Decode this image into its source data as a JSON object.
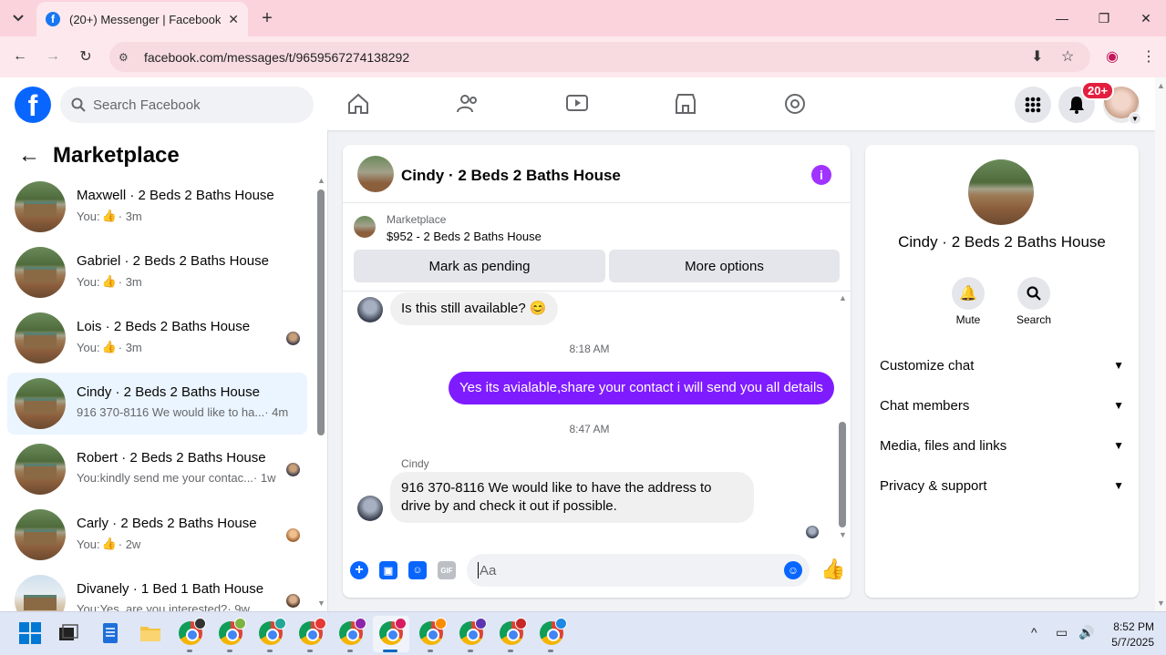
{
  "browser": {
    "tab_title": "(20+) Messenger | Facebook",
    "url": "facebook.com/messages/t/9659567274138292"
  },
  "header": {
    "search_placeholder": "Search Facebook",
    "notification_count": "20+"
  },
  "left_panel": {
    "title": "Marketplace",
    "conversations": [
      {
        "name": "Maxwell · 2 Beds 2 Baths House",
        "prefix": "You:",
        "preview": "",
        "like": true,
        "time": "· 3m"
      },
      {
        "name": "Gabriel · 2 Beds 2 Baths House",
        "prefix": "You:",
        "preview": "",
        "like": true,
        "time": "· 3m"
      },
      {
        "name": "Lois · 2 Beds 2 Baths House",
        "prefix": "You:",
        "preview": "",
        "like": true,
        "time": "· 3m"
      },
      {
        "name": "Cindy · 2 Beds 2 Baths House",
        "prefix": "",
        "preview": "916 370-8116 We would like to ha...",
        "like": false,
        "time": " · 4m"
      },
      {
        "name": "Robert · 2 Beds 2 Baths House",
        "prefix": "You:",
        "preview": " kindly send me your contac...",
        "like": false,
        "time": " · 1w"
      },
      {
        "name": "Carly · 2 Beds 2 Baths House",
        "prefix": "You:",
        "preview": "",
        "like": true,
        "time": "· 2w"
      },
      {
        "name": "Divanely · 1 Bed 1 Bath House",
        "prefix": "You:",
        "preview": " Yes, are you interested?",
        "like": false,
        "time": " · 9w"
      }
    ]
  },
  "chat": {
    "title": "Cindy · 2 Beds 2 Baths House",
    "marketplace_label": "Marketplace",
    "listing": "$952 - 2 Beds 2 Baths House",
    "mark_pending": "Mark as pending",
    "more_options": "More options",
    "messages": {
      "in1": "Is this still available? 😊",
      "time1": "8:18 AM",
      "out1": "Yes its avialable,share your contact i will send you all details",
      "time2": "8:47 AM",
      "sender": "Cindy",
      "in2": "916 370-8116 We would like to have the address to drive by and check it out if possible."
    },
    "composer_placeholder": "Aa"
  },
  "right_panel": {
    "name": "Cindy · 2 Beds 2 Baths House",
    "mute": "Mute",
    "search": "Search",
    "sections": [
      "Customize chat",
      "Chat members",
      "Media, files and links",
      "Privacy & support"
    ]
  },
  "taskbar": {
    "time": "8:52 PM",
    "date": "5/7/2025"
  },
  "colors": {
    "fb_blue": "#0866ff",
    "outgoing_bubble": "#7f1cff",
    "active_conv_bg": "#ebf5ff",
    "badge_red": "#e41e3f"
  }
}
